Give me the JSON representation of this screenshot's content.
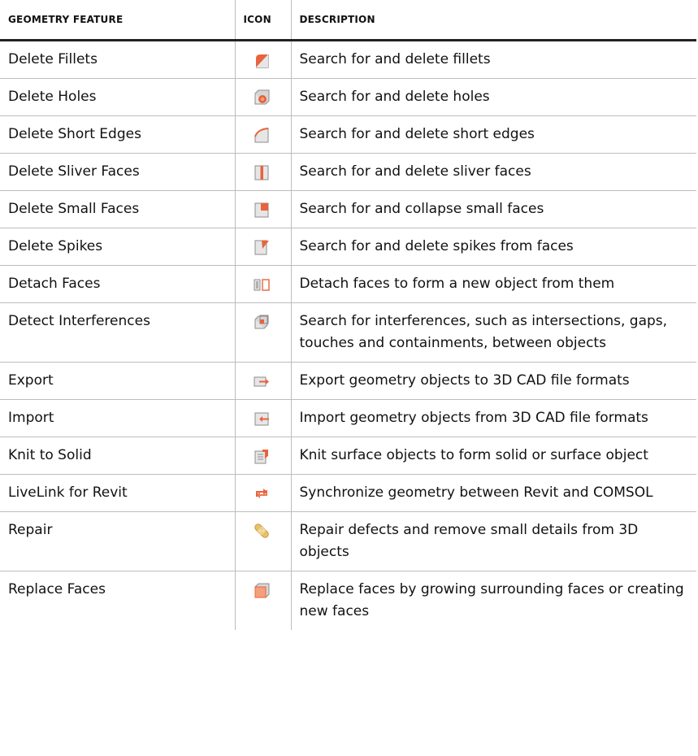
{
  "headers": {
    "feature": "GEOMETRY FEATURE",
    "icon": "ICON",
    "description": "DESCRIPTION"
  },
  "colors": {
    "accent_orange": "#e8643c",
    "light_orange": "#f4a07a",
    "gray_fill": "#e6e6e6",
    "gray_stroke": "#8c8c8c",
    "tan": "#e7c06c"
  },
  "rows": [
    {
      "feature": "Delete Fillets",
      "icon": "delete-fillets-icon",
      "description": "Search for and delete fillets"
    },
    {
      "feature": "Delete Holes",
      "icon": "delete-holes-icon",
      "description": "Search for and delete holes"
    },
    {
      "feature": "Delete Short Edges",
      "icon": "delete-short-edges-icon",
      "description": "Search for and delete short edges"
    },
    {
      "feature": "Delete Sliver Faces",
      "icon": "delete-sliver-faces-icon",
      "description": "Search for and delete sliver faces"
    },
    {
      "feature": "Delete Small Faces",
      "icon": "delete-small-faces-icon",
      "description": "Search for and collapse small faces"
    },
    {
      "feature": "Delete Spikes",
      "icon": "delete-spikes-icon",
      "description": "Search for and delete spikes from faces"
    },
    {
      "feature": "Detach Faces",
      "icon": "detach-faces-icon",
      "description": "Detach faces to form a new object from them"
    },
    {
      "feature": "Detect Interferences",
      "icon": "detect-interferences-icon",
      "description": "Search for interferences, such as intersections, gaps, touches and containments, between objects"
    },
    {
      "feature": "Export",
      "icon": "export-icon",
      "description": "Export geometry objects to 3D CAD file formats"
    },
    {
      "feature": "Import",
      "icon": "import-icon",
      "description": "Import geometry objects from 3D CAD file formats"
    },
    {
      "feature": "Knit to Solid",
      "icon": "knit-to-solid-icon",
      "description": "Knit surface objects to form solid or surface object"
    },
    {
      "feature": "LiveLink for Revit",
      "icon": "livelink-revit-icon",
      "description": "Synchronize geometry between Revit and COMSOL"
    },
    {
      "feature": "Repair",
      "icon": "repair-icon",
      "description": "Repair defects and remove small details from 3D objects"
    },
    {
      "feature": "Replace Faces",
      "icon": "replace-faces-icon",
      "description": "Replace faces by growing surrounding faces or creating new faces"
    }
  ]
}
